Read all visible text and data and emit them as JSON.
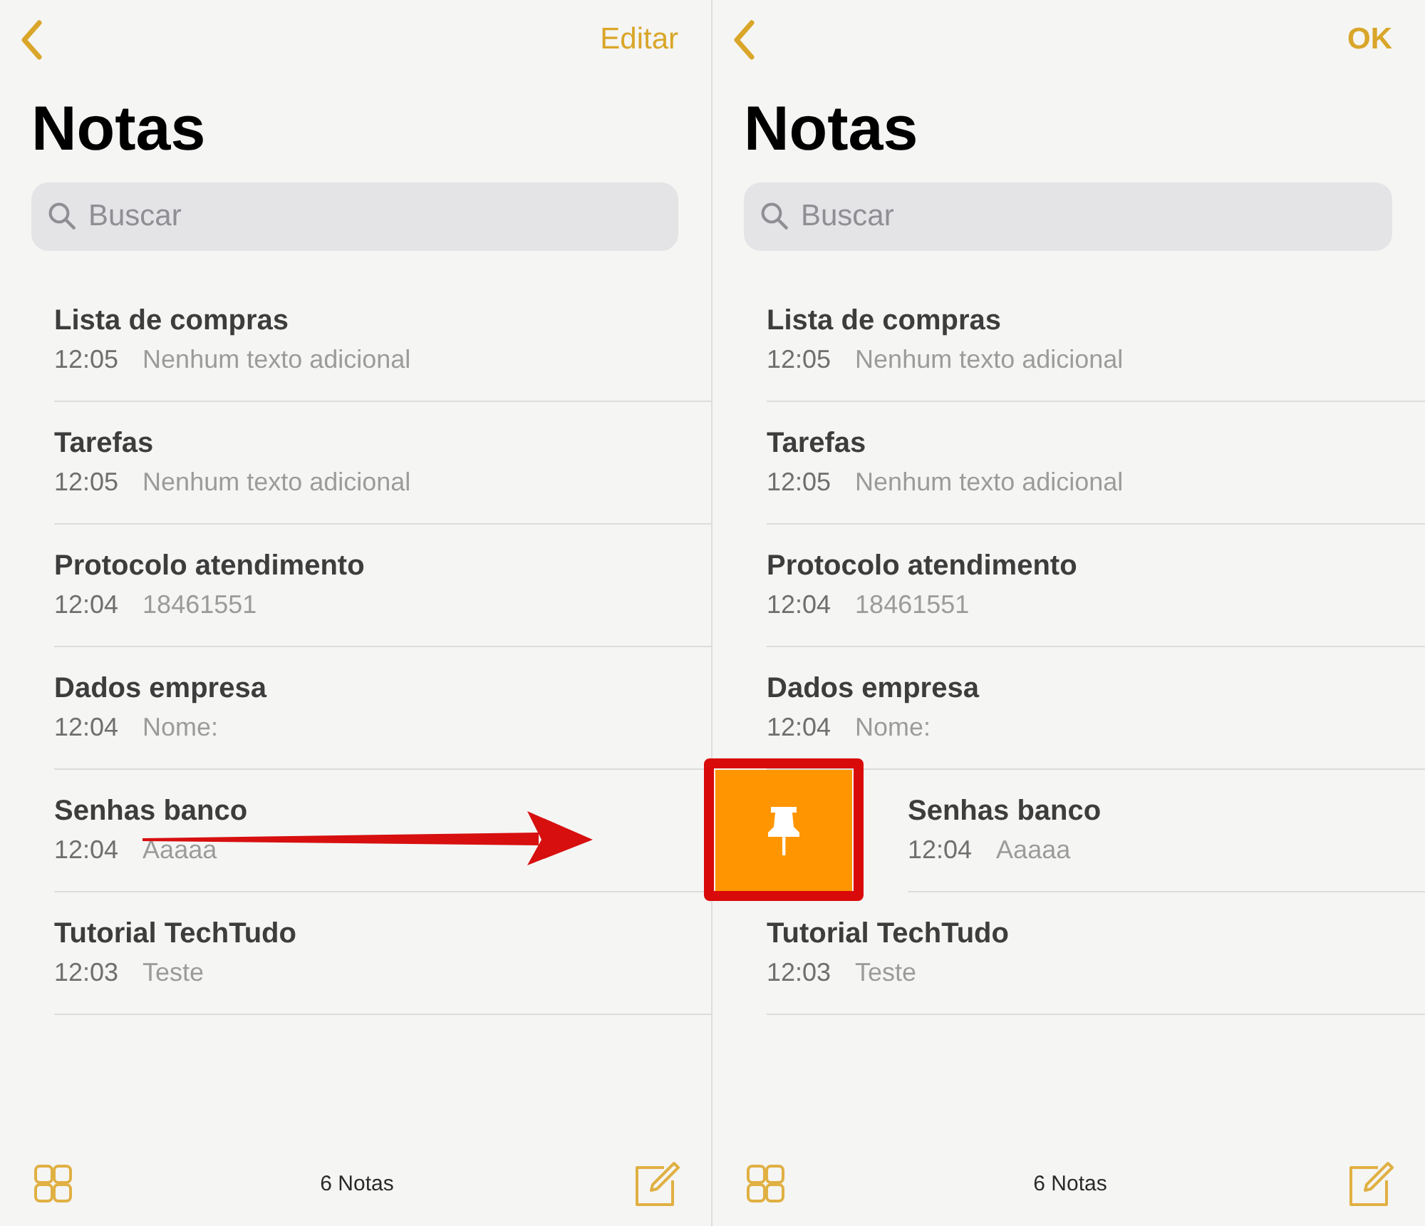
{
  "panels": [
    {
      "nav": {
        "action": "Editar",
        "bold": false
      },
      "title": "Notas",
      "search": {
        "placeholder": "Buscar"
      },
      "notes": [
        {
          "title": "Lista de compras",
          "time": "12:05",
          "preview": "Nenhum texto adicional",
          "swiped": false,
          "arrow": false,
          "highlighted": false
        },
        {
          "title": "Tarefas",
          "time": "12:05",
          "preview": "Nenhum texto adicional",
          "swiped": false,
          "arrow": false,
          "highlighted": false
        },
        {
          "title": "Protocolo atendimento",
          "time": "12:04",
          "preview": "18461551",
          "swiped": false,
          "arrow": false,
          "highlighted": false
        },
        {
          "title": "Dados empresa",
          "time": "12:04",
          "preview": "Nome:",
          "swiped": false,
          "arrow": false,
          "highlighted": false
        },
        {
          "title": "Senhas banco",
          "time": "12:04",
          "preview": "Aaaaa",
          "swiped": false,
          "arrow": true,
          "highlighted": false
        },
        {
          "title": "Tutorial TechTudo",
          "time": "12:03",
          "preview": "Teste",
          "swiped": false,
          "arrow": false,
          "highlighted": false
        }
      ],
      "footer": {
        "count": "6 Notas"
      }
    },
    {
      "nav": {
        "action": "OK",
        "bold": true
      },
      "title": "Notas",
      "search": {
        "placeholder": "Buscar"
      },
      "notes": [
        {
          "title": "Lista de compras",
          "time": "12:05",
          "preview": "Nenhum texto adicional",
          "swiped": false,
          "arrow": false,
          "highlighted": false
        },
        {
          "title": "Tarefas",
          "time": "12:05",
          "preview": "Nenhum texto adicional",
          "swiped": false,
          "arrow": false,
          "highlighted": false
        },
        {
          "title": "Protocolo atendimento",
          "time": "12:04",
          "preview": "18461551",
          "swiped": false,
          "arrow": false,
          "highlighted": false
        },
        {
          "title": "Dados empresa",
          "time": "12:04",
          "preview": "Nome:",
          "swiped": false,
          "arrow": false,
          "highlighted": false
        },
        {
          "title": "Senhas banco",
          "time": "12:04",
          "preview": "Aaaaa",
          "swiped": true,
          "arrow": false,
          "highlighted": true
        },
        {
          "title": "Tutorial TechTudo",
          "time": "12:03",
          "preview": "Teste",
          "swiped": false,
          "arrow": false,
          "highlighted": false
        }
      ],
      "footer": {
        "count": "6 Notas"
      }
    }
  ]
}
